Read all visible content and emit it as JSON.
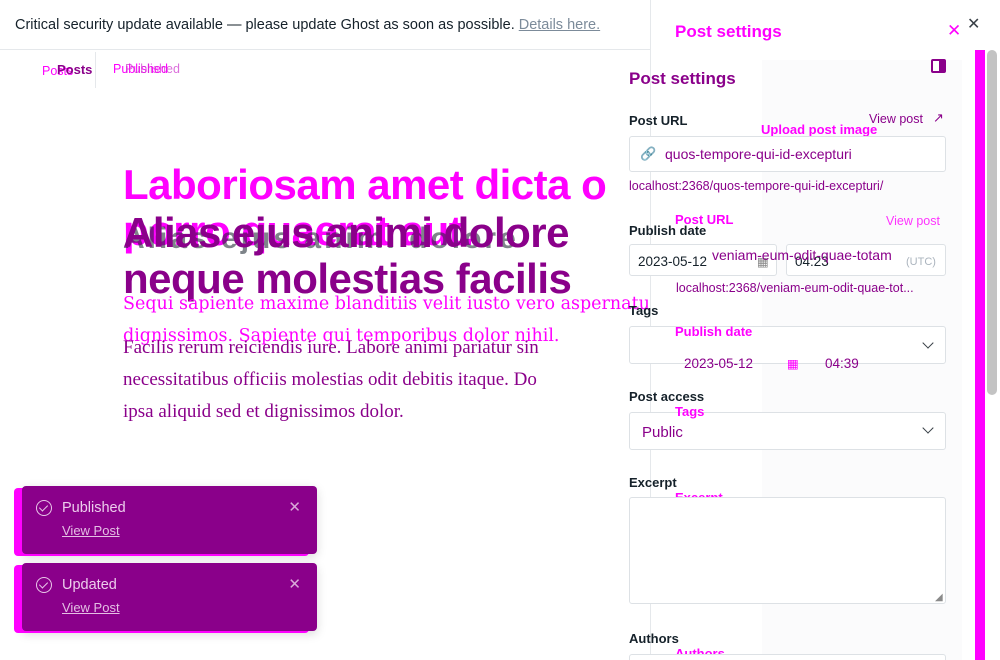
{
  "banner": {
    "message": "Critical security update available — please update Ghost as soon as possible.",
    "link": "Details here."
  },
  "breadcrumb": {
    "posts_ghost": "Posts",
    "posts": "Posts",
    "status": "Published",
    "status_ghost": "Published"
  },
  "editor": {
    "title_back": [
      "Laboriosam amet dicta o",
      "porro quaerat aut."
    ],
    "title_front": [
      "Alias ejus animi dolore",
      "neque molestias facilis"
    ],
    "title_ghost": "Alias ejus animi dolore",
    "body_back": [
      "Sequi sapiente maxime blanditiis velit iusto vero aspernatu",
      "dignissimos. Sapiente qui temporibus dolor nihil."
    ],
    "body_front": [
      "Facilis rerum reiciendis iure. Labore animi pariatur sin",
      "necessitatibus officiis molestias odit debitis itaque. Do",
      "ipsa aliquid sed et dignissimos dolor."
    ]
  },
  "toasts": [
    {
      "title": "Published",
      "link": "View Post"
    },
    {
      "title": "Updated",
      "link": "View Post"
    }
  ],
  "settings": {
    "header_ghost": "Post settings",
    "header": "Post settings",
    "upload_image": "Upload post image",
    "post_url_label": "Post URL",
    "view_post": "View post",
    "slug": "quos-tempore-qui-id-excepturi",
    "url_preview": "localhost:2368/quos-tempore-qui-id-excepturi/",
    "post_url_label_ghost": "Post URL",
    "view_post_ghost": "View post",
    "slug_ghost": "veniam-eum-odit-quae-totam",
    "url_preview_ghost": "localhost:2368/veniam-eum-odit-quae-tot...",
    "publish_date_label": "Publish date",
    "date": "2023-05-12",
    "time": "04:23",
    "tz": "(UTC)",
    "publish_date_label_ghost": "Publish date",
    "date_ghost": "2023-05-12",
    "time_ghost": "04:39",
    "tags_label": "Tags",
    "tags_label_ghost": "Tags",
    "access_label": "Post access",
    "access_value": "Public",
    "excerpt_label": "Excerpt",
    "excerpt_label_ghost": "Excerpt",
    "authors_label": "Authors",
    "authors_label_ghost": "Authors"
  },
  "colors": {
    "magenta": "#ff00ff",
    "purple": "#8a008a"
  }
}
